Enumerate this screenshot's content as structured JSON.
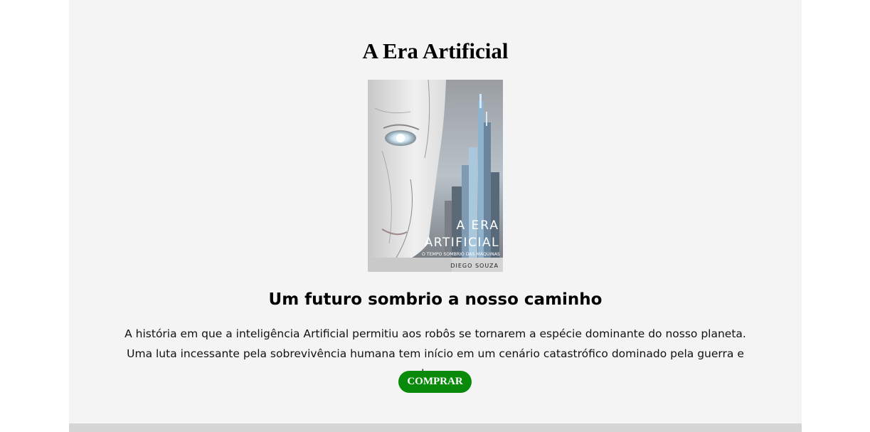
{
  "book": {
    "title": "A Era Artificial",
    "cover": {
      "title_line1": "A ERA",
      "title_line2": "ARTIFICIAL",
      "tagline": "O TEMPO SOMBRIO DAS MÁQUINAS",
      "author": "DIEGO SOUZA"
    },
    "headline": "Um futuro sombrio a nosso caminho",
    "description": "A história em que a inteligência Artificial permitiu aos robôs se tornarem a espécie dominante do nosso planeta. Uma luta incessante pela sobrevivência humana tem início em um cenário catastrófico dominado pela guerra e pelo caos.",
    "buy_label": "COMPRAR"
  },
  "colors": {
    "page_background": "#f4f4f4",
    "button_background": "#0a8a0a",
    "button_text": "#ffffff"
  }
}
